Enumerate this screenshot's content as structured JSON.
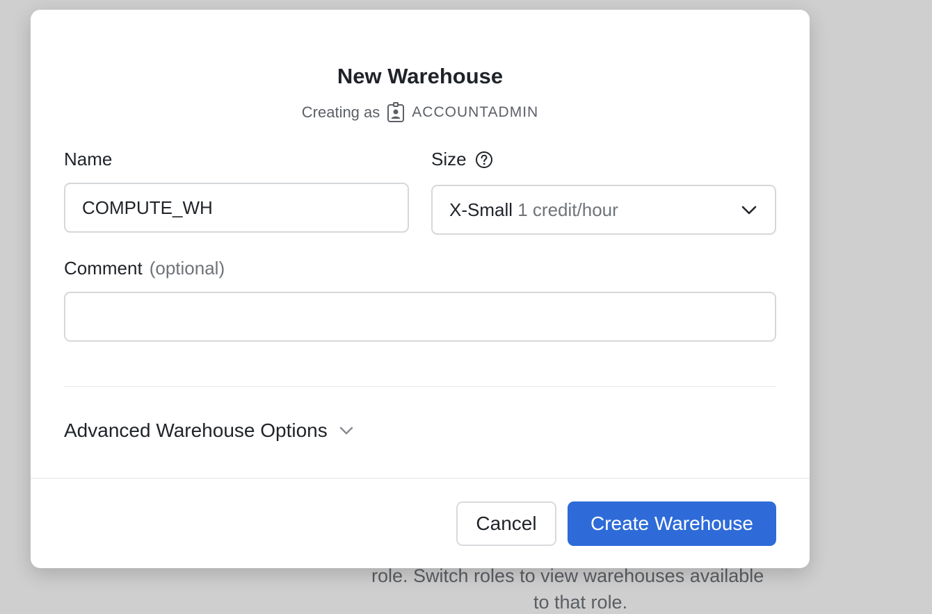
{
  "background": {
    "text_line1": "role. Switch roles to view warehouses available",
    "text_line2": "to that role."
  },
  "modal": {
    "title": "New Warehouse",
    "subtitle_prefix": "Creating as",
    "role": "ACCOUNTADMIN",
    "name": {
      "label": "Name",
      "value": "COMPUTE_WH"
    },
    "size": {
      "label": "Size",
      "value": "X-Small",
      "detail": "1 credit/hour"
    },
    "comment": {
      "label": "Comment",
      "optional": "(optional)",
      "value": ""
    },
    "advanced_label": "Advanced Warehouse Options",
    "cancel_label": "Cancel",
    "create_label": "Create Warehouse"
  },
  "colors": {
    "primary": "#2e6bd9",
    "backdrop": "#cfcfcf"
  },
  "icons": [
    "role-badge-icon",
    "help-icon",
    "chevron-down-icon"
  ]
}
